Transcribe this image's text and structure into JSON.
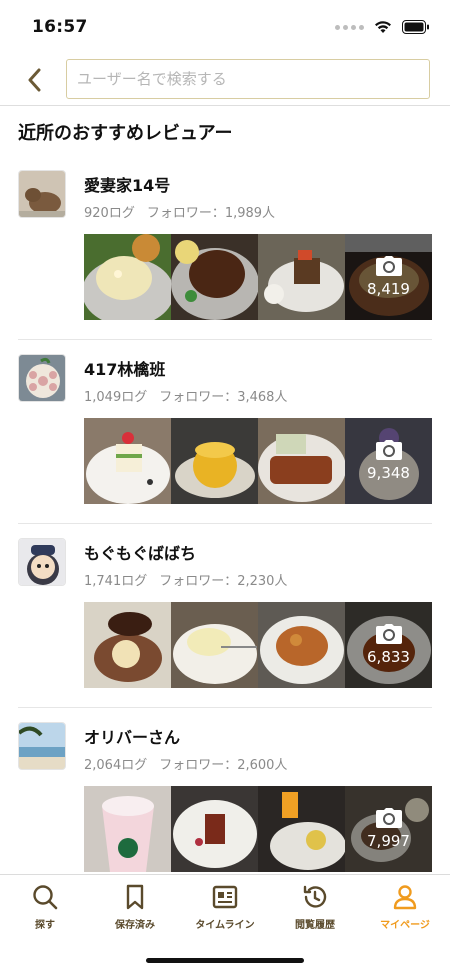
{
  "status": {
    "time": "16:57"
  },
  "header": {
    "search_placeholder": "ユーザー名で検索する"
  },
  "section_title": "近所のおすすめレビュアー",
  "reviewers": [
    {
      "name": "愛妻家14号",
      "logs": "920ログ",
      "followers": "フォロワー：1,989人",
      "photo_count": "8,419"
    },
    {
      "name": "417林檎班",
      "logs": "1,049ログ",
      "followers": "フォロワー：3,468人",
      "photo_count": "9,348"
    },
    {
      "name": "もぐもぐばばち",
      "logs": "1,741ログ",
      "followers": "フォロワー：2,230人",
      "photo_count": "6,833"
    },
    {
      "name": "オリバーさん",
      "logs": "2,064ログ",
      "followers": "フォロワー：2,600人",
      "photo_count": "7,997"
    }
  ],
  "tabs": [
    {
      "label": "探す",
      "icon": "search-icon"
    },
    {
      "label": "保存済み",
      "icon": "bookmark-icon"
    },
    {
      "label": "タイムライン",
      "icon": "timeline-icon"
    },
    {
      "label": "閲覧履歴",
      "icon": "history-icon"
    },
    {
      "label": "マイページ",
      "icon": "person-icon"
    }
  ],
  "colors": {
    "accent": "#f09b1e",
    "icon_brown": "#5a4a2c",
    "search_border": "#d8cda2"
  }
}
